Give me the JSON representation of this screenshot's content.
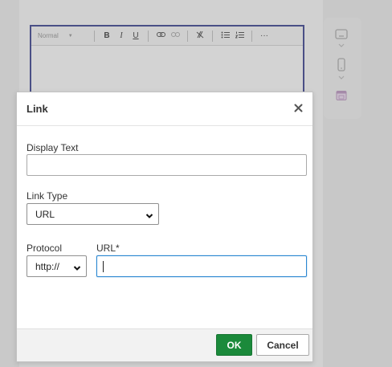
{
  "editor": {
    "toolbar": {
      "format_label": "Normal",
      "bold": "B",
      "italic": "I",
      "underline": "U",
      "more": "···"
    }
  },
  "dialog": {
    "title": "Link",
    "display_text": {
      "label": "Display Text",
      "value": ""
    },
    "link_type": {
      "label": "Link Type",
      "selected": "URL"
    },
    "protocol": {
      "label": "Protocol",
      "selected": "http://"
    },
    "url": {
      "label": "URL*",
      "value": ""
    },
    "ok_label": "OK",
    "cancel_label": "Cancel"
  },
  "colors": {
    "ok_button": "#1b8a3b",
    "focus_border": "#2b87d1",
    "editor_border": "#4a4f86"
  },
  "icons": {
    "close": "close-icon",
    "side_panel": [
      "desktop-icon",
      "chevron-down-icon",
      "mobile-icon",
      "chevron-down-icon",
      "calendar-icon"
    ]
  }
}
